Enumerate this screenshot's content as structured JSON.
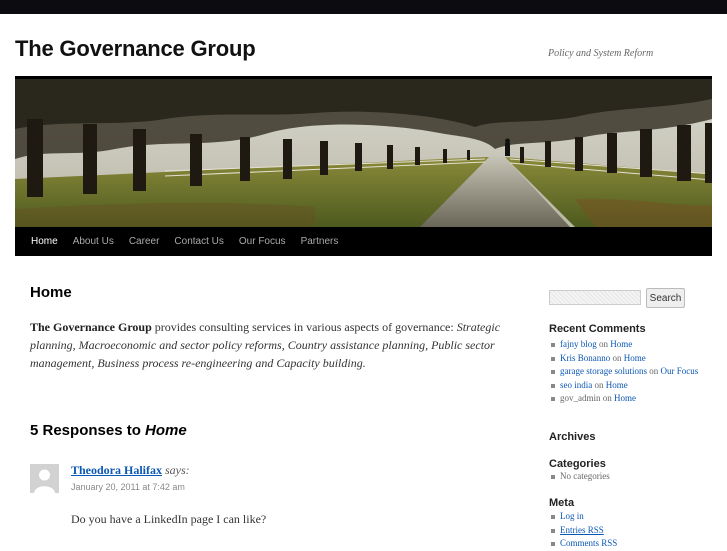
{
  "site": {
    "title": "The Governance Group",
    "description": "Policy and System Reform"
  },
  "nav": {
    "items": [
      {
        "label": "Home",
        "current": true
      },
      {
        "label": "About Us"
      },
      {
        "label": "Career"
      },
      {
        "label": "Contact Us"
      },
      {
        "label": "Our Focus"
      },
      {
        "label": "Partners"
      }
    ]
  },
  "page": {
    "title": "Home",
    "intro_bold": "The Governance Group",
    "intro_text": " provides consulting services in various aspects of governance: ",
    "intro_italic": "Strategic planning, Macroeconomic and sector policy reforms, Country assistance planning, Public sector management, Business process re-engineering and Capacity building."
  },
  "comments": {
    "title_prefix": "5 Responses to ",
    "title_subject": "Home",
    "items": [
      {
        "author": "Theodora Halifax",
        "says": " says:",
        "date": "January 20, 2011 at 7:42 am",
        "body": "Do you have a LinkedIn page I can like?"
      }
    ]
  },
  "sidebar": {
    "search_button": "Search",
    "recent_comments_title": "Recent Comments",
    "recent_comments": [
      {
        "author": "fajny blog",
        "on": " on ",
        "post": "Home"
      },
      {
        "author": "Kris Bonanno",
        "on": " on ",
        "post": "Home"
      },
      {
        "author": "garage storage solutions",
        "on": " on ",
        "post": "Our Focus"
      },
      {
        "author": "seo india",
        "on": " on ",
        "post": "Home"
      },
      {
        "author": "gov_admin",
        "on": " on ",
        "post": "Home"
      }
    ],
    "archives_title": "Archives",
    "categories_title": "Categories",
    "categories_empty": "No categories",
    "meta_title": "Meta",
    "meta_links": [
      "Log in",
      "Entries RSS",
      "Comments RSS"
    ]
  },
  "colors": {
    "link": "#0b57b4",
    "nav_bg": "#000000",
    "topbar": "#0c0c10"
  }
}
